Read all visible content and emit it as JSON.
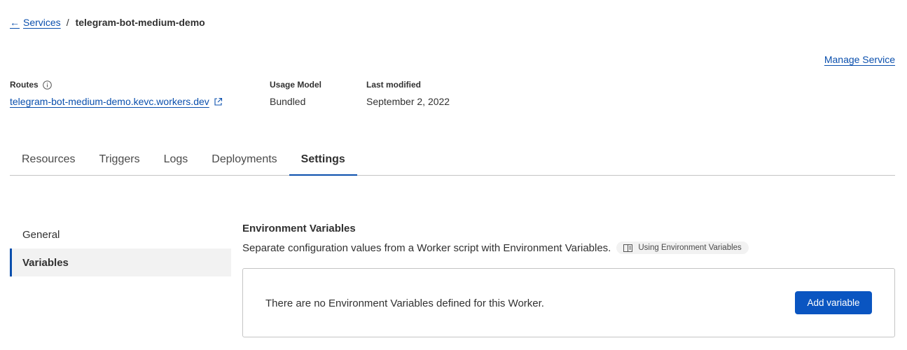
{
  "breadcrumb": {
    "back_label": "Services",
    "separator": "/",
    "current": "telegram-bot-medium-demo"
  },
  "manage_service_label": "Manage Service",
  "meta": {
    "routes_label": "Routes",
    "routes_value": "telegram-bot-medium-demo.kevc.workers.dev",
    "usage_model_label": "Usage Model",
    "usage_model_value": "Bundled",
    "last_modified_label": "Last modified",
    "last_modified_value": "September 2, 2022"
  },
  "tabs": [
    {
      "label": "Resources",
      "active": false
    },
    {
      "label": "Triggers",
      "active": false
    },
    {
      "label": "Logs",
      "active": false
    },
    {
      "label": "Deployments",
      "active": false
    },
    {
      "label": "Settings",
      "active": true
    }
  ],
  "sidenav": [
    {
      "label": "General",
      "active": false
    },
    {
      "label": "Variables",
      "active": true
    }
  ],
  "env_vars": {
    "title": "Environment Variables",
    "description": "Separate configuration values from a Worker script with Environment Variables.",
    "doc_link_label": "Using Environment Variables",
    "empty_message": "There are no Environment Variables defined for this Worker.",
    "add_button_label": "Add variable"
  },
  "colors": {
    "link": "#0a4fad",
    "primary_button": "#0a55c1",
    "active_indicator": "#0a4fad"
  },
  "icons": {
    "back": "arrow-left-icon",
    "info": "info-icon",
    "external": "external-link-icon",
    "docs": "book-icon"
  }
}
